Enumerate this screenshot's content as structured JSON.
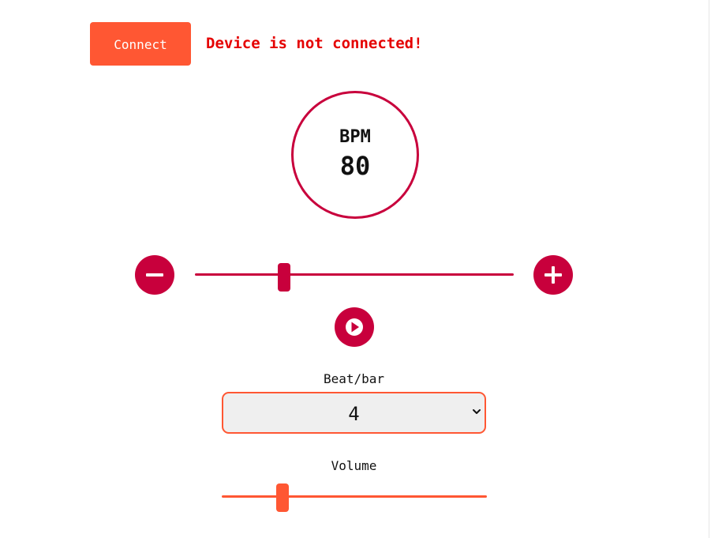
{
  "connect": {
    "button_label": "Connect",
    "status_message": "Device is not connected!"
  },
  "tempo": {
    "label": "BPM",
    "value": "80",
    "slider_fraction": 0.28
  },
  "controls": {
    "decrease_icon": "minus-icon",
    "increase_icon": "plus-icon",
    "play_icon": "play-icon"
  },
  "beat_per_bar": {
    "label": "Beat/bar",
    "selected_value": "4"
  },
  "volume": {
    "label": "Volume",
    "slider_fraction": 0.23
  },
  "colors": {
    "accent_orange": "#ff5733",
    "accent_crimson": "#c8003c",
    "status_red": "#e50000"
  }
}
